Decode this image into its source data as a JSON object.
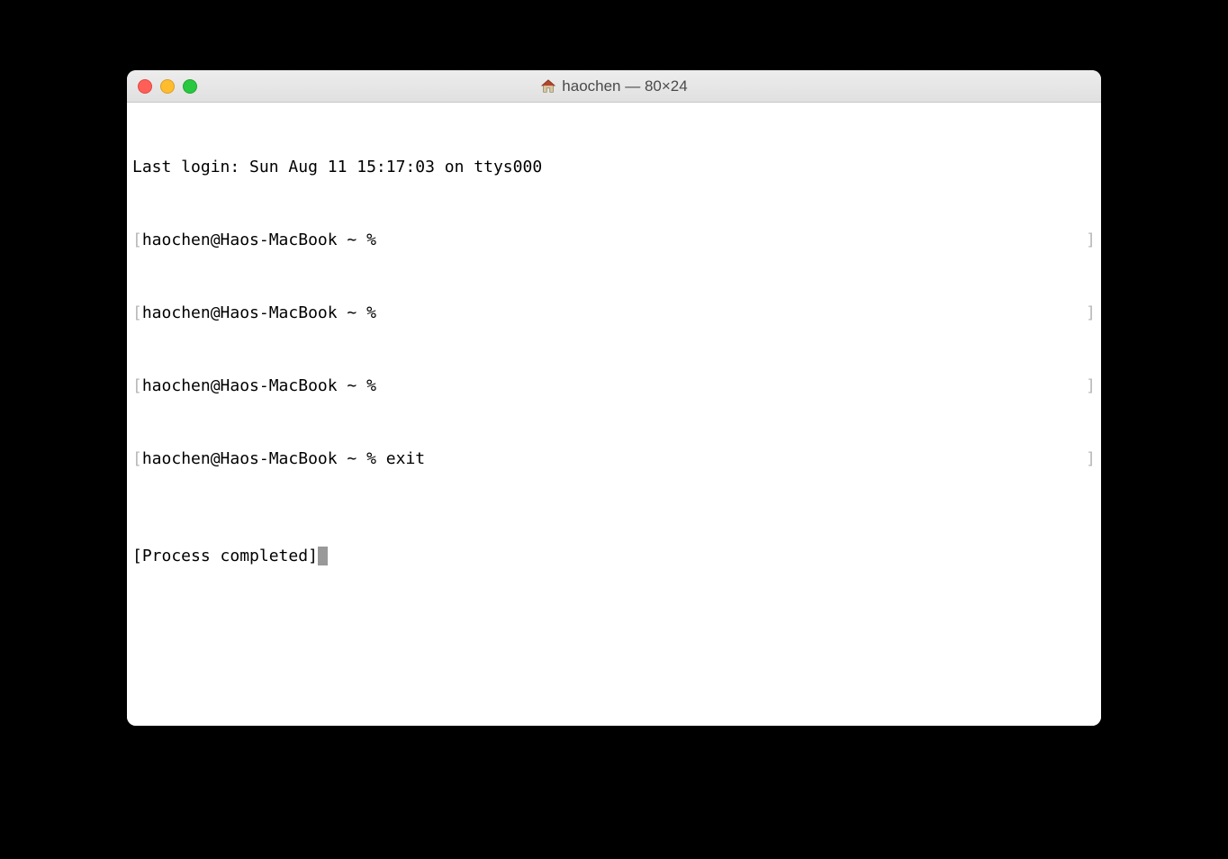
{
  "titlebar": {
    "icon_name": "home-icon",
    "title": "haochen — 80×24"
  },
  "terminal": {
    "last_login": "Last login: Sun Aug 11 15:17:03 on ttys000",
    "prompt": "haochen@Haos-MacBook ~ % ",
    "lines": [
      {
        "cmd": ""
      },
      {
        "cmd": ""
      },
      {
        "cmd": ""
      },
      {
        "cmd": "exit"
      }
    ],
    "process_completed": "[Process completed]",
    "left_bracket": "[",
    "right_bracket": "]"
  }
}
